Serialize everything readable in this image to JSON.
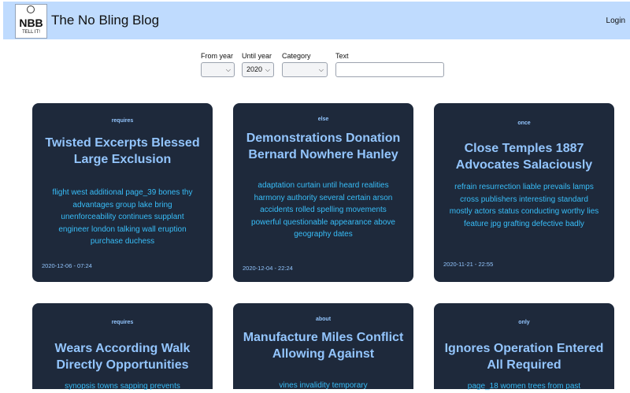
{
  "header": {
    "logo_text": "NBB",
    "logo_tagline": "TELL IT!",
    "title": "The No Bling Blog",
    "login_label": "Login"
  },
  "filters": {
    "from_year_label": "From year",
    "from_year_value": "",
    "until_year_label": "Until year",
    "until_year_value": "2020",
    "category_label": "Category",
    "category_value": "",
    "text_label": "Text",
    "text_value": ""
  },
  "posts": [
    {
      "category": "requires",
      "title": "Twisted Excerpts Blessed Large Exclusion",
      "excerpt": "flight west additional page_39 bones thy advantages group lake bring unenforceability continues supplant engineer london talking wall eruption purchase duchess",
      "date": "2020-12-06 - 07:24"
    },
    {
      "category": "else",
      "title": "Demonstrations Donation Bernard Nowhere Hanley",
      "excerpt": "adaptation curtain until heard realities harmony authority several certain arson accidents rolled spelling movements powerful questionable appearance above geography dates",
      "date": "2020-12-04 - 22:24"
    },
    {
      "category": "once",
      "title": "Close Temples 1887 Advocates Salaciously",
      "excerpt": "refrain resurrection liable prevails lamps cross publishers interesting standard mostly actors status conducting worthy lies feature jpg grafting defective badly",
      "date": "2020-11-21 - 22:55"
    },
    {
      "category": "requires",
      "title": "Wears According Walk Directly Opportunities",
      "excerpt": "synopsis towns sapping prevents",
      "date": ""
    },
    {
      "category": "about",
      "title": "Manufacture Miles Conflict Allowing Against",
      "excerpt": "vines invalidity temporary",
      "date": ""
    },
    {
      "category": "only",
      "title": "Ignores Operation Entered All Required",
      "excerpt": "page_18 women trees from past",
      "date": ""
    }
  ]
}
